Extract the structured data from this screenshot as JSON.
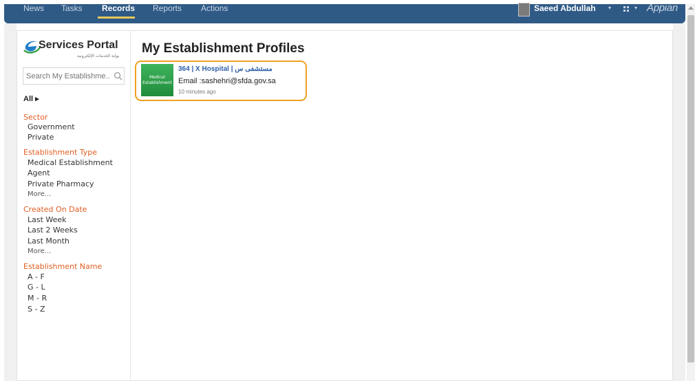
{
  "nav": {
    "items": [
      {
        "label": "News",
        "active": false
      },
      {
        "label": "Tasks",
        "active": false
      },
      {
        "label": "Records",
        "active": true
      },
      {
        "label": "Reports",
        "active": false
      },
      {
        "label": "Actions",
        "active": false
      }
    ],
    "user_name": "Saeed Abdullah",
    "brand": "Appian",
    "caret": "▾",
    "colors": {
      "bar": "#2f5a86",
      "active_underline": "#e6c85a"
    }
  },
  "sidebar": {
    "logo_title": "Services Portal",
    "logo_subtitle": "بوابة الخدمات الإلكترونية",
    "search_placeholder": "Search My Establishme...",
    "all_label": "All ▸",
    "facets": [
      {
        "title": "Sector",
        "items": [
          "Government",
          "Private"
        ]
      },
      {
        "title": "Establishment Type",
        "items": [
          "Medical Establishment",
          "Agent",
          "Private Pharmacy"
        ],
        "more": "More..."
      },
      {
        "title": "Created On Date",
        "items": [
          "Last Week",
          "Last 2 Weeks",
          "Last Month"
        ],
        "more": "More..."
      },
      {
        "title": "Establishment Name",
        "items": [
          "A - F",
          "G - L",
          "M - R",
          "S - Z"
        ]
      }
    ],
    "facet_color": "#e25d21"
  },
  "main": {
    "title": "My Establishment Profiles",
    "records": [
      {
        "thumb_label": "Medical Establishment",
        "link": "364 | X Hospital | مستشفى س",
        "email": "Email :sashehri@sfda.gov.sa",
        "time": "10 minutes ago"
      }
    ],
    "highlight_color": "#f0a020"
  }
}
